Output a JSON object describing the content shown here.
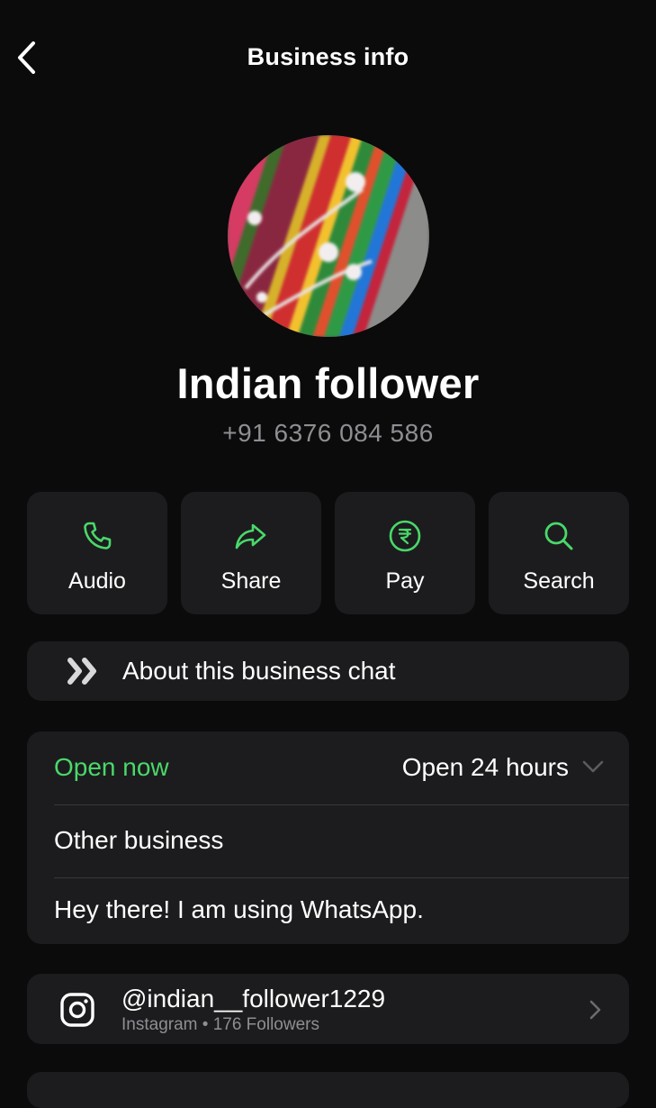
{
  "header": {
    "title": "Business info",
    "back_icon": "chevron-left-icon"
  },
  "profile": {
    "name": "Indian follower",
    "phone": "+91 6376 084 586"
  },
  "actions": [
    {
      "label": "Audio",
      "icon": "phone-icon"
    },
    {
      "label": "Share",
      "icon": "share-arrow-icon"
    },
    {
      "label": "Pay",
      "icon": "rupee-icon"
    },
    {
      "label": "Search",
      "icon": "search-icon"
    }
  ],
  "about_chat": {
    "label": "About this business chat",
    "icon": "double-chevron-icon"
  },
  "business": {
    "status": "Open now",
    "hours": "Open 24 hours",
    "category": "Other business",
    "about": "Hey there! I am using WhatsApp."
  },
  "instagram": {
    "handle": "@indian__follower1229",
    "platform": "Instagram",
    "separator": "•",
    "followers": "176 Followers"
  },
  "colors": {
    "background": "#0b0b0b",
    "card": "#1c1c1e",
    "accent_green": "#4ad86a",
    "secondary_text": "#8e8e93"
  }
}
